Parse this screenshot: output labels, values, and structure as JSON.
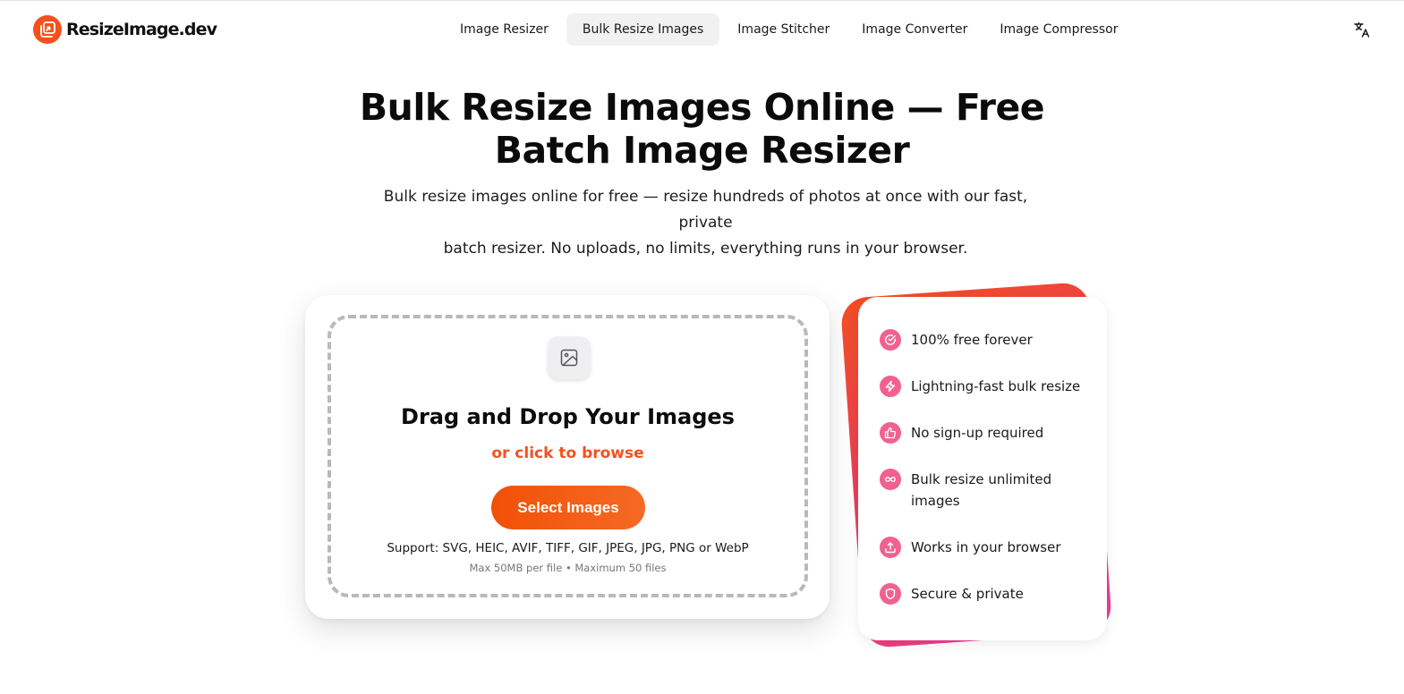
{
  "header": {
    "logo_text": "ResizeImage.dev",
    "nav": [
      {
        "label": "Image Resizer",
        "active": false
      },
      {
        "label": "Bulk Resize Images",
        "active": true
      },
      {
        "label": "Image Stitcher",
        "active": false
      },
      {
        "label": "Image Converter",
        "active": false
      },
      {
        "label": "Image Compressor",
        "active": false
      }
    ],
    "language_icon": "translate-icon"
  },
  "hero": {
    "title_line1": "Bulk Resize Images Online — Free",
    "title_line2": "Batch Image Resizer",
    "subtitle_line1": "Bulk resize images online for free — resize hundreds of photos at once with our fast, private",
    "subtitle_line2": "batch resizer. No uploads, no limits, everything runs in your browser."
  },
  "upload": {
    "icon": "image-icon",
    "title": "Drag and Drop Your Images",
    "browse_text": "or click to browse",
    "button_label": "Select Images",
    "support_text": "Support: SVG, HEIC, AVIF, TIFF, GIF, JPEG, JPG, PNG or WebP",
    "limits_text": "Max 50MB per file • Maximum 50 files"
  },
  "features": [
    {
      "icon": "check-circle-icon",
      "text": "100% free forever"
    },
    {
      "icon": "lightning-icon",
      "text": "Lightning-fast bulk resize"
    },
    {
      "icon": "thumbs-up-icon",
      "text": "No sign-up required"
    },
    {
      "icon": "infinity-icon",
      "text": "Bulk resize unlimited images"
    },
    {
      "icon": "upload-icon",
      "text": "Works in your browser"
    },
    {
      "icon": "shield-icon",
      "text": "Secure & private"
    }
  ],
  "colors": {
    "accent": "#f4511e",
    "feature_icon_bg": "#f06192",
    "button_gradient_start": "#f25007",
    "button_gradient_end": "#f56a24"
  }
}
